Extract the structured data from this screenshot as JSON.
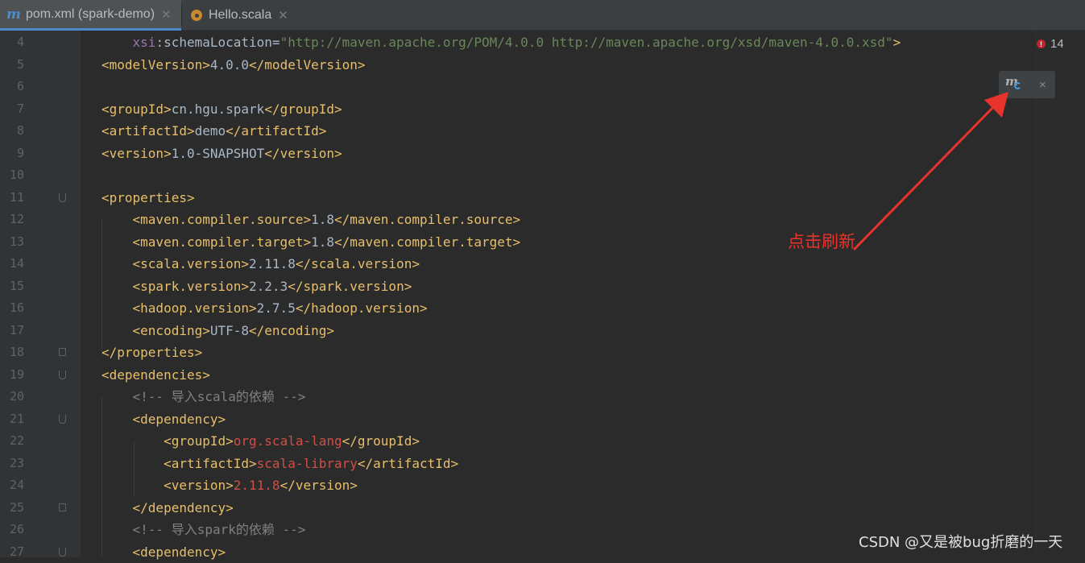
{
  "tabs": [
    {
      "label": "pom.xml (spark-demo)",
      "icon": "maven-icon",
      "active": true
    },
    {
      "label": "Hello.scala",
      "icon": "scala-object-icon",
      "active": false
    }
  ],
  "editor": {
    "lines": [
      {
        "n": "4",
        "fold": "",
        "tokens": [
          [
            "sp",
            "    "
          ],
          [
            "ns",
            "xsi"
          ],
          [
            "tx",
            ":schemaLocation="
          ],
          [
            "s",
            "\"http://maven.apache.org/POM/4.0.0 http://maven.apache.org/xsd/maven-4.0.0.xsd\""
          ],
          [
            "t",
            ">"
          ]
        ]
      },
      {
        "n": "5",
        "fold": "",
        "tokens": [
          [
            "t",
            "<modelVersion>"
          ],
          [
            "tx",
            "4.0.0"
          ],
          [
            "t",
            "</modelVersion>"
          ]
        ]
      },
      {
        "n": "6",
        "fold": "",
        "tokens": []
      },
      {
        "n": "7",
        "fold": "",
        "tokens": [
          [
            "t",
            "<groupId>"
          ],
          [
            "tx",
            "cn.hgu.spark"
          ],
          [
            "t",
            "</groupId>"
          ]
        ]
      },
      {
        "n": "8",
        "fold": "",
        "tokens": [
          [
            "t",
            "<artifactId>"
          ],
          [
            "tx",
            "demo"
          ],
          [
            "t",
            "</artifactId>"
          ]
        ]
      },
      {
        "n": "9",
        "fold": "",
        "tokens": [
          [
            "t",
            "<version>"
          ],
          [
            "tx",
            "1.0-SNAPSHOT"
          ],
          [
            "t",
            "</version>"
          ]
        ]
      },
      {
        "n": "10",
        "fold": "",
        "tokens": []
      },
      {
        "n": "11",
        "fold": "open",
        "tokens": [
          [
            "t",
            "<properties>"
          ]
        ]
      },
      {
        "n": "12",
        "fold": "",
        "tokens": [
          [
            "sp",
            "    "
          ],
          [
            "t",
            "<maven.compiler.source>"
          ],
          [
            "tx",
            "1.8"
          ],
          [
            "t",
            "</maven.compiler.source>"
          ]
        ]
      },
      {
        "n": "13",
        "fold": "",
        "tokens": [
          [
            "sp",
            "    "
          ],
          [
            "t",
            "<maven.compiler.target>"
          ],
          [
            "tx",
            "1.8"
          ],
          [
            "t",
            "</maven.compiler.target>"
          ]
        ]
      },
      {
        "n": "14",
        "fold": "",
        "tokens": [
          [
            "sp",
            "    "
          ],
          [
            "t",
            "<scala.version>"
          ],
          [
            "tx",
            "2.11.8"
          ],
          [
            "t",
            "</scala.version>"
          ]
        ]
      },
      {
        "n": "15",
        "fold": "",
        "tokens": [
          [
            "sp",
            "    "
          ],
          [
            "t",
            "<spark.version>"
          ],
          [
            "tx",
            "2.2.3"
          ],
          [
            "t",
            "</spark.version>"
          ]
        ]
      },
      {
        "n": "16",
        "fold": "",
        "tokens": [
          [
            "sp",
            "    "
          ],
          [
            "t",
            "<hadoop.version>"
          ],
          [
            "tx",
            "2.7.5"
          ],
          [
            "t",
            "</hadoop.version>"
          ]
        ]
      },
      {
        "n": "17",
        "fold": "",
        "tokens": [
          [
            "sp",
            "    "
          ],
          [
            "t",
            "<encoding>"
          ],
          [
            "tx",
            "UTF-8"
          ],
          [
            "t",
            "</encoding>"
          ]
        ]
      },
      {
        "n": "18",
        "fold": "close",
        "tokens": [
          [
            "t",
            "</properties>"
          ]
        ]
      },
      {
        "n": "19",
        "fold": "open",
        "tokens": [
          [
            "t",
            "<dependencies>"
          ]
        ]
      },
      {
        "n": "20",
        "fold": "",
        "tokens": [
          [
            "sp",
            "    "
          ],
          [
            "c",
            "<!-- 导入scala的依赖 -->"
          ]
        ]
      },
      {
        "n": "21",
        "fold": "open",
        "tokens": [
          [
            "sp",
            "    "
          ],
          [
            "t",
            "<dependency>"
          ]
        ]
      },
      {
        "n": "22",
        "fold": "",
        "tokens": [
          [
            "sp",
            "        "
          ],
          [
            "t",
            "<groupId>"
          ],
          [
            "r",
            "org.scala-lang"
          ],
          [
            "t",
            "</groupId>"
          ]
        ]
      },
      {
        "n": "23",
        "fold": "",
        "tokens": [
          [
            "sp",
            "        "
          ],
          [
            "t",
            "<artifactId>"
          ],
          [
            "r",
            "scala-library"
          ],
          [
            "t",
            "</artifactId>"
          ]
        ]
      },
      {
        "n": "24",
        "fold": "",
        "tokens": [
          [
            "sp",
            "        "
          ],
          [
            "t",
            "<version>"
          ],
          [
            "r",
            "2.11.8"
          ],
          [
            "t",
            "</version>"
          ]
        ]
      },
      {
        "n": "25",
        "fold": "close",
        "tokens": [
          [
            "sp",
            "    "
          ],
          [
            "t",
            "</dependency>"
          ]
        ]
      },
      {
        "n": "26",
        "fold": "",
        "tokens": [
          [
            "sp",
            "    "
          ],
          [
            "c",
            "<!-- 导入spark的依赖 -->"
          ]
        ]
      },
      {
        "n": "27",
        "fold": "open",
        "tokens": [
          [
            "sp",
            "    "
          ],
          [
            "t",
            "<dependency>"
          ]
        ]
      }
    ]
  },
  "inspections": {
    "error_count": "14",
    "error_icon": "error-icon"
  },
  "maven_popup": {
    "icon": "maven-reload-icon",
    "close": "×"
  },
  "annotation": {
    "text": "点击刷新",
    "color": "#e7332b"
  },
  "watermark": {
    "text": "CSDN @又是被bug折磨的一天"
  },
  "colors": {
    "background": "#2b2b2b",
    "gutter": "#313335",
    "tag": "#e8bf6a",
    "text": "#a9b7c6",
    "comment": "#808080",
    "string": "#6a8759",
    "red_value": "#cf4f47",
    "accent": "#4a88c7"
  }
}
